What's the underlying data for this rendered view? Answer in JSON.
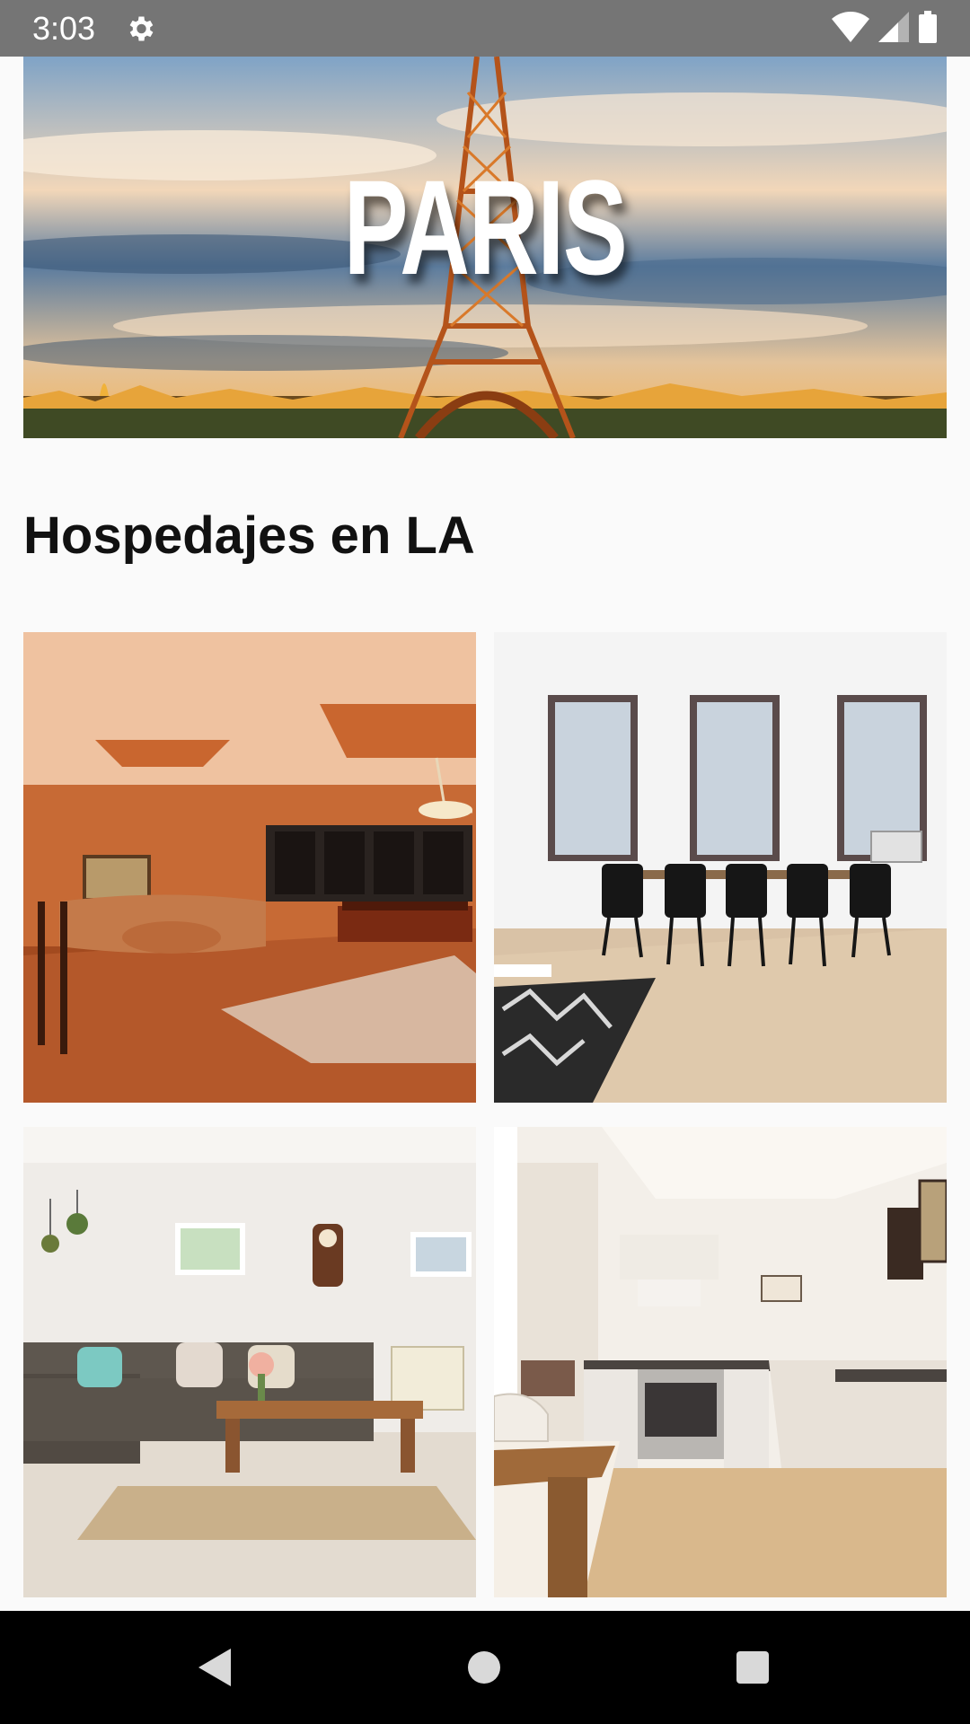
{
  "status_bar": {
    "time": "3:03",
    "icons": [
      "settings-gear-icon",
      "wifi-icon",
      "signal-icon",
      "battery-icon"
    ]
  },
  "hero": {
    "title": "PARIS",
    "image": "eiffel-tower-sunset-banner"
  },
  "section": {
    "title": "Hospedajes en LA"
  },
  "listings": [
    {
      "image": "living-room-with-pool-table"
    },
    {
      "image": "dining-room-with-black-chairs"
    },
    {
      "image": "living-room-with-grey-sofa"
    },
    {
      "image": "white-kitchen-with-wood-floor"
    }
  ],
  "nav_bar": {
    "icons": [
      "back-icon",
      "home-icon",
      "recents-icon"
    ]
  },
  "colors": {
    "status_bar": "#757575",
    "background": "#fafafa",
    "nav_bar": "#000000",
    "title_text": "#111111"
  }
}
